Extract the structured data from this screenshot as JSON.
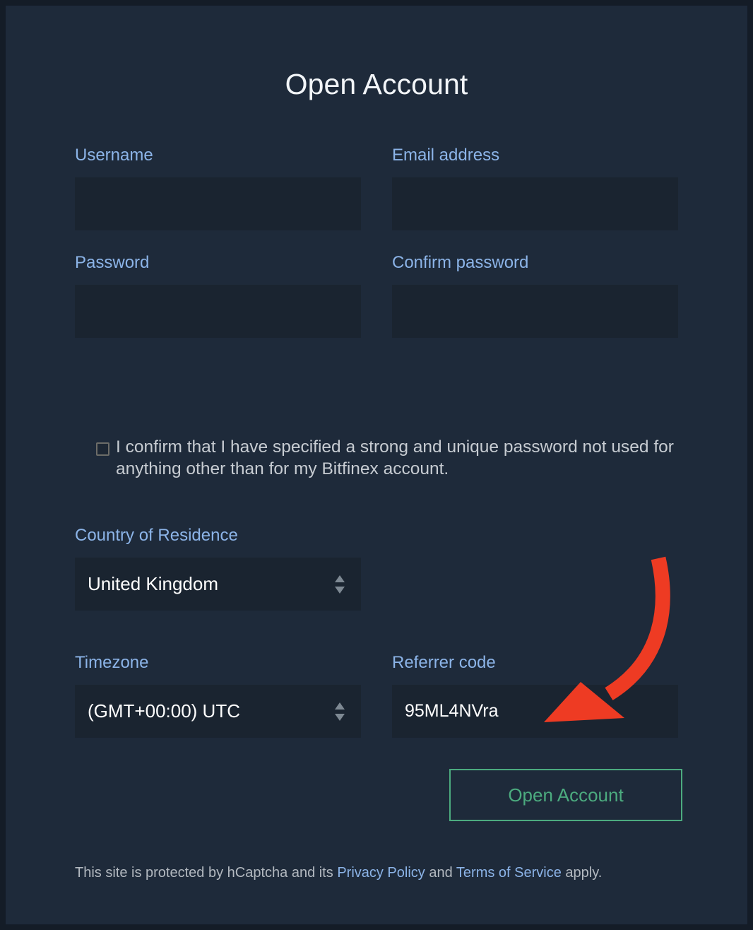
{
  "page": {
    "title": "Open Account",
    "background_color": "#1e2a3a",
    "frame_color": "#141c27",
    "label_color": "#8cb4e8",
    "accent_green": "#4cab7f",
    "annotation_red": "#ee3b23"
  },
  "form": {
    "username": {
      "label": "Username",
      "value": "",
      "placeholder": ""
    },
    "email": {
      "label": "Email address",
      "value": "",
      "placeholder": ""
    },
    "password": {
      "label": "Password",
      "value": "",
      "placeholder": ""
    },
    "confirm_password": {
      "label": "Confirm password",
      "value": "",
      "placeholder": ""
    },
    "confirm_checkbox": {
      "label": "I confirm that I have specified a strong and unique password not used for anything other than for my Bitfinex account.",
      "checked": false
    },
    "country": {
      "label": "Country of Residence",
      "value": "United Kingdom",
      "icon": "updown-spinner-icon"
    },
    "timezone": {
      "label": "Timezone",
      "value": "(GMT+00:00) UTC",
      "icon": "updown-spinner-icon"
    },
    "referrer": {
      "label": "Referrer code",
      "value": "95ML4NVra",
      "placeholder": ""
    },
    "submit": {
      "label": "Open Account"
    }
  },
  "footer": {
    "text_before": "This site is protected by hCaptcha and its ",
    "privacy_link": "Privacy Policy",
    "text_middle": " and ",
    "terms_link": "Terms of Service",
    "text_after": " apply."
  },
  "annotation": {
    "type": "curved-arrow",
    "color": "#ee3b23",
    "points_to": "referrer-code-input"
  }
}
